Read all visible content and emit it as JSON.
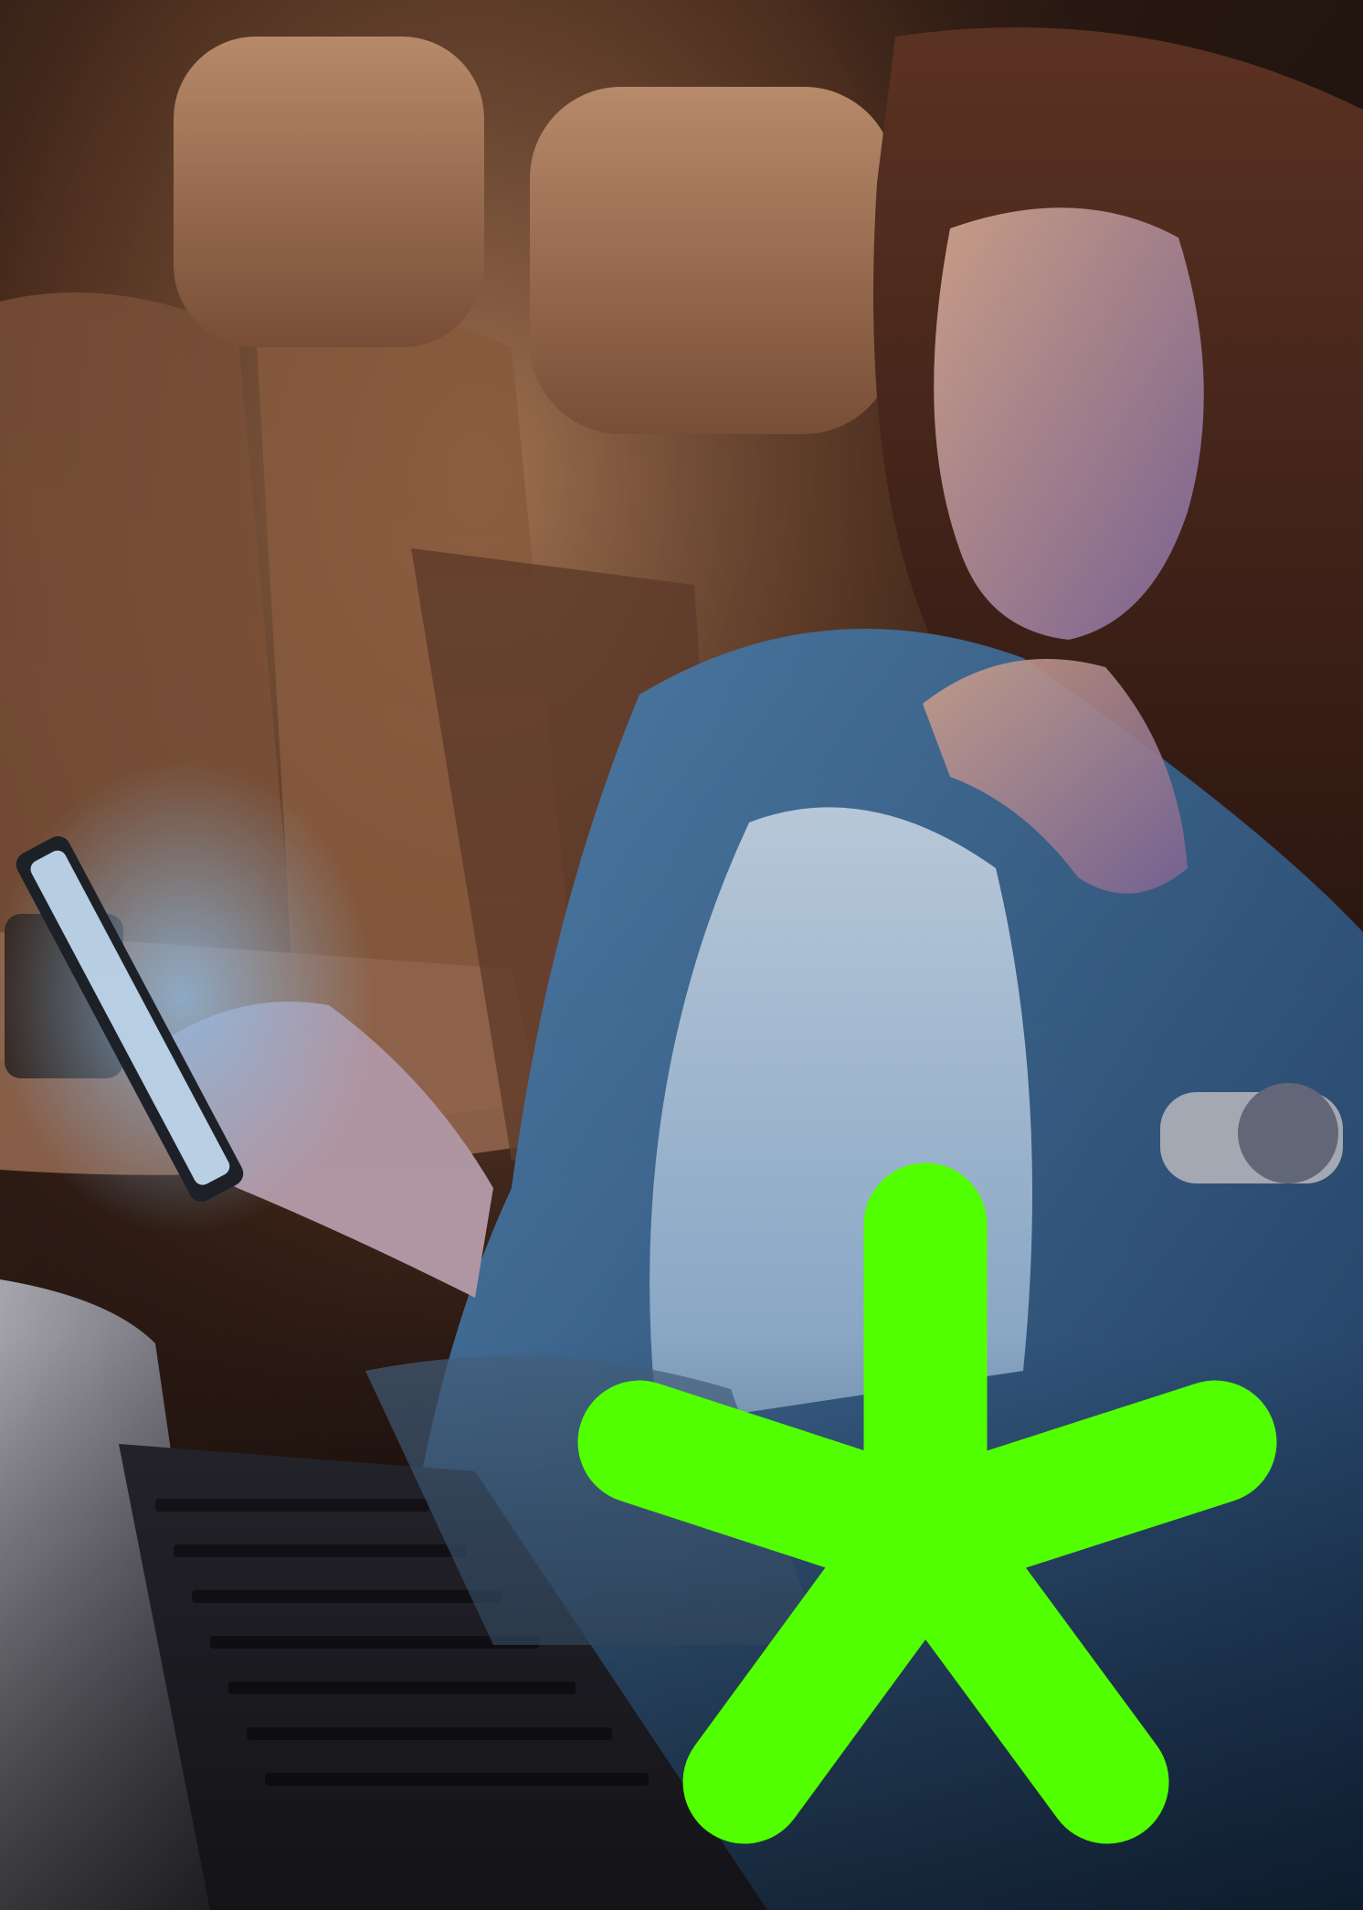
{
  "image": {
    "subject": "photo",
    "accent_color": "#52ff00"
  },
  "graphic": {
    "icon": "asterisk-icon",
    "color": "#52ff00"
  }
}
